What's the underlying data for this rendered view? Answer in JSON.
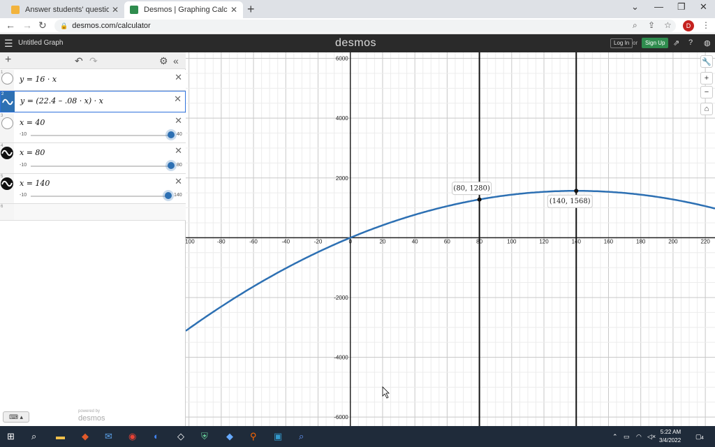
{
  "browser": {
    "tabs": [
      {
        "title": "Answer students' questions and",
        "active": false
      },
      {
        "title": "Desmos | Graphing Calculator",
        "active": true
      }
    ],
    "url": "desmos.com/calculator",
    "profile_initial": "D"
  },
  "header": {
    "graph_title": "Untitled Graph",
    "brand": "desmos",
    "login": "Log In",
    "or": "or",
    "signup": "Sign Up"
  },
  "expressions": [
    {
      "index": "1",
      "latex": "y  =  16 · x",
      "type": "plain"
    },
    {
      "index": "2",
      "latex": "y  =  (22.4 – .08 · x) · x",
      "type": "wave-blue",
      "selected": true
    },
    {
      "index": "3",
      "latex": "x = 40",
      "type": "plain",
      "slider": {
        "min": "-10",
        "max": "40",
        "value": 40
      }
    },
    {
      "index": "4",
      "latex": "x = 80",
      "type": "wave-dark",
      "slider": {
        "min": "-10",
        "max": "80",
        "value": 80
      }
    },
    {
      "index": "5",
      "latex": "x = 140",
      "type": "wave-dark",
      "slider": {
        "min": "-10",
        "max": "140",
        "value": 140
      }
    },
    {
      "index": "6"
    }
  ],
  "footer": {
    "powered": "powered by",
    "brand": "desmos"
  },
  "graph": {
    "x_ticks": [
      "-100",
      "-80",
      "-60",
      "-40",
      "-20",
      "0",
      "20",
      "40",
      "60",
      "80",
      "100",
      "120",
      "140",
      "160",
      "180",
      "200",
      "220"
    ],
    "y_ticks": [
      "6000",
      "4000",
      "2000",
      "-2000",
      "-4000",
      "-6000"
    ],
    "xlim": [
      -102,
      226
    ],
    "ylim": [
      -6300,
      6200
    ],
    "vertical_lines": [
      80,
      140
    ],
    "points": [
      {
        "x": 80,
        "y": 1280,
        "label": "(80, 1280)"
      },
      {
        "x": 140,
        "y": 1568,
        "label": "(140, 1568)"
      }
    ],
    "curve_color": "#2d70b3"
  },
  "taskbar": {
    "time": "5:22 AM",
    "date": "3/4/2022",
    "notif": "4"
  }
}
